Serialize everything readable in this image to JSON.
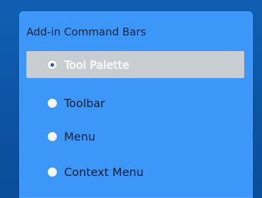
{
  "panel": {
    "title": "Add-in Command Bars",
    "options": [
      {
        "label": "Tool Palette",
        "selected": true
      },
      {
        "label": "Toolbar",
        "selected": false
      },
      {
        "label": "Menu",
        "selected": false
      },
      {
        "label": "Context Menu",
        "selected": false
      }
    ]
  },
  "colors": {
    "background": "#0d57a8",
    "panel": "#3d97f8",
    "selected_row": "#c8cdd1"
  }
}
